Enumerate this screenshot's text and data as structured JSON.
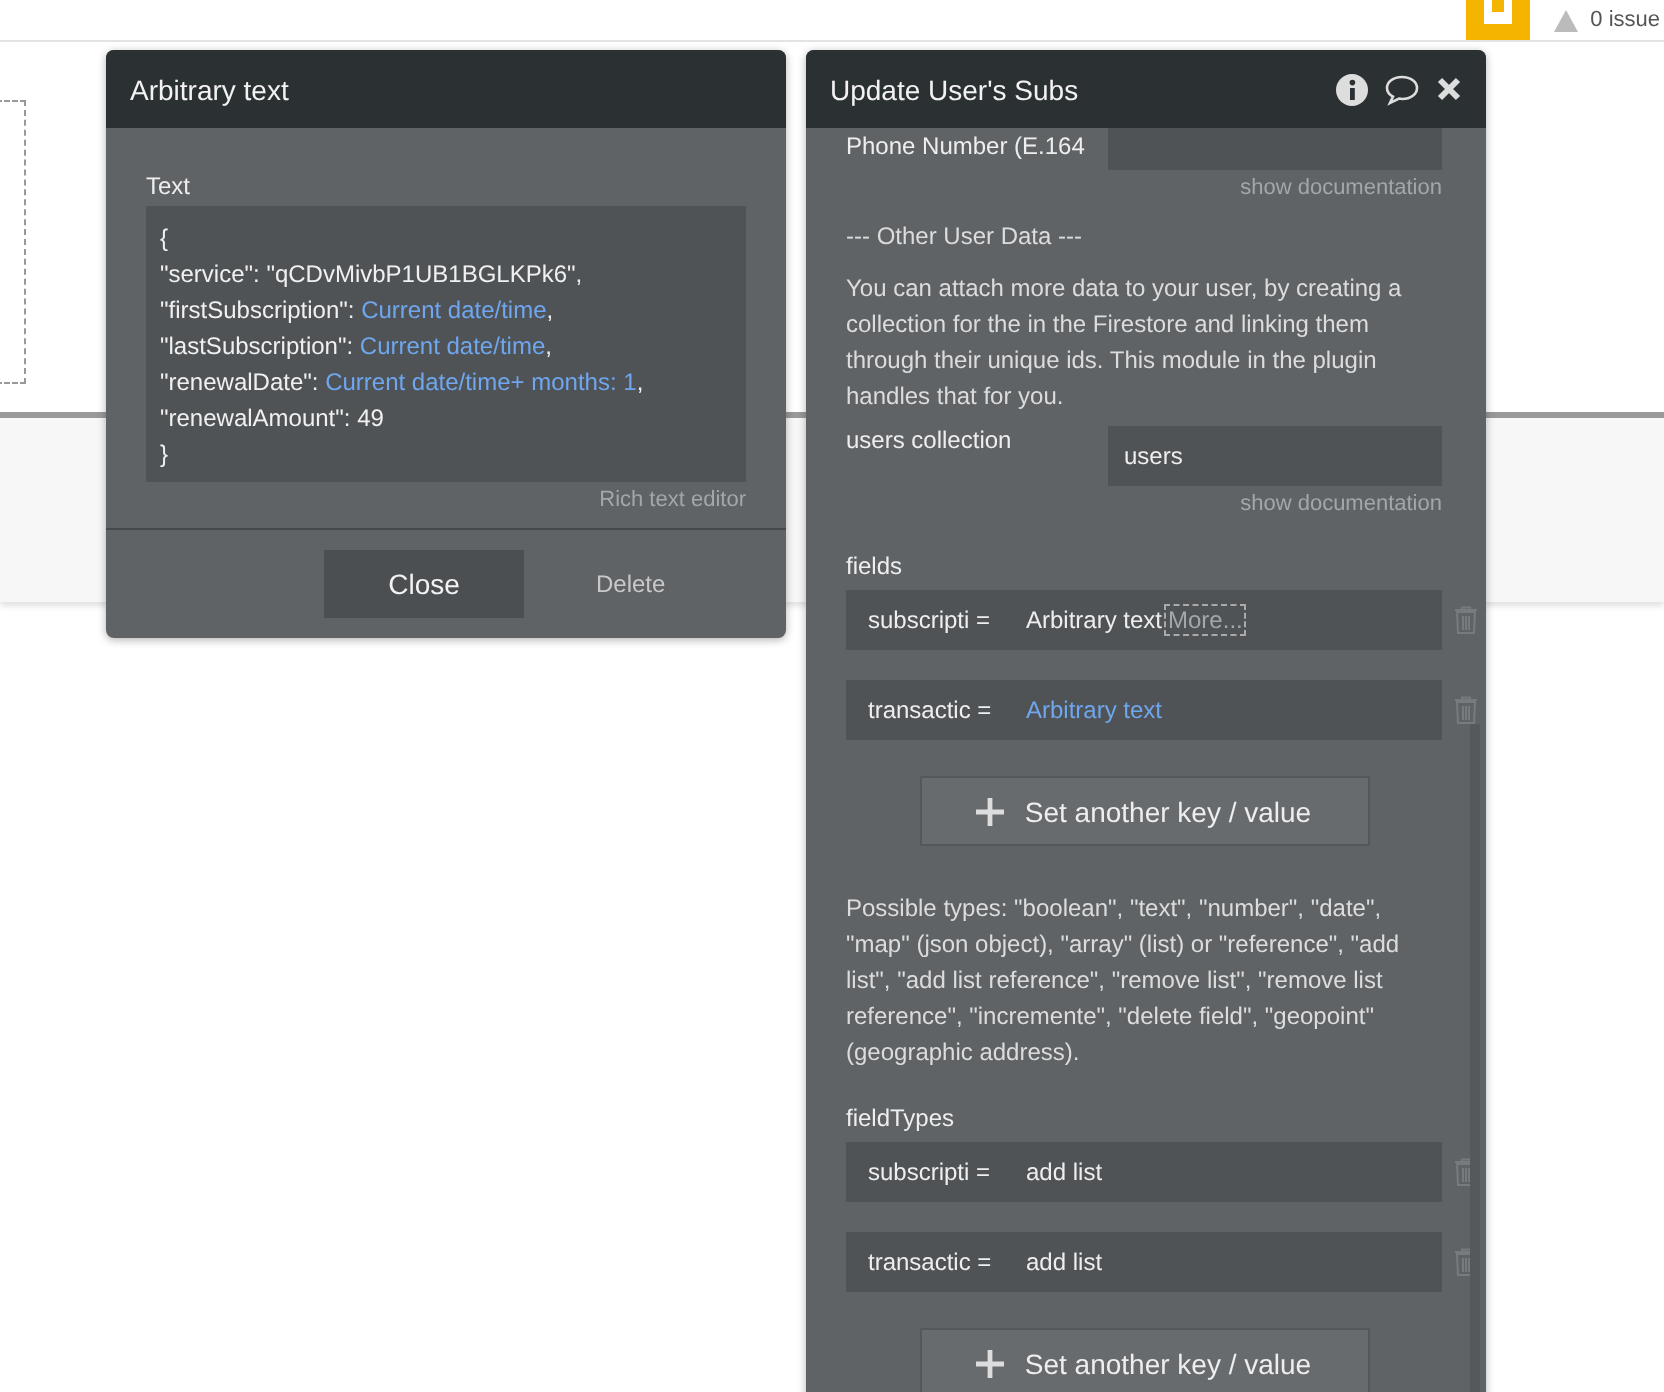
{
  "topbar": {
    "issues": "0 issue"
  },
  "text_editor": {
    "title": "Arbitrary text",
    "label": "Text",
    "lines": [
      [
        {
          "text": "{",
          "kind": "plain"
        }
      ],
      [
        {
          "text": "\"service\": \"qCDvMivbP1UB1BGLKPk6\",",
          "kind": "plain"
        }
      ],
      [
        {
          "text": "\"firstSubscription\": ",
          "kind": "plain"
        },
        {
          "text": "Current date/time",
          "kind": "dynamic"
        },
        {
          "text": ",",
          "kind": "plain"
        }
      ],
      [
        {
          "text": "\"lastSubscription\": ",
          "kind": "plain"
        },
        {
          "text": "Current date/time",
          "kind": "dynamic"
        },
        {
          "text": ",",
          "kind": "plain"
        }
      ],
      [
        {
          "text": "\"renewalDate\": ",
          "kind": "plain"
        },
        {
          "text": "Current date/time+ months: 1",
          "kind": "dynamic"
        },
        {
          "text": ",",
          "kind": "plain"
        }
      ],
      [
        {
          "text": "\"renewalAmount\": 49",
          "kind": "plain"
        }
      ],
      [
        {
          "text": "}",
          "kind": "plain"
        }
      ]
    ],
    "rich_text_link": "Rich text editor",
    "close_button": "Close",
    "delete_button": "Delete"
  },
  "action_panel": {
    "title": "Update User's Subs",
    "items": [
      {
        "kind": "input",
        "label": "Phone Number (E.164"
      },
      {
        "kind": "doc",
        "text": "show documentation"
      },
      {
        "kind": "note",
        "text": "--- Other User Data ---"
      },
      {
        "kind": "note",
        "text": "You can attach more data to your user, by creating a collection for the in the Firestore and linking them through their unique ids. This module in the plugin handles that for you."
      },
      {
        "kind": "input",
        "label": "users collection",
        "value": "users"
      },
      {
        "kind": "doc",
        "text": "show documentation"
      },
      {
        "kind": "heading",
        "text": "fields"
      },
      {
        "kind": "pair",
        "key": "subscripti =",
        "value": "Arbitrary text",
        "dynamic": false,
        "more": "More..."
      },
      {
        "kind": "pair",
        "key": "transactic =",
        "value": "Arbitrary text",
        "dynamic": true
      },
      {
        "kind": "add",
        "text": "Set another key / value"
      },
      {
        "kind": "note",
        "text": "Possible types: \"boolean\", \"text\", \"number\", \"date\", \"map\" (json object), \"array\" (list) or \"reference\", \"add list\", \"add list reference\", \"remove list\", \"remove list reference\", \"incremente\", \"delete field\", \"geopoint\" (geographic address)."
      },
      {
        "kind": "heading",
        "text": "fieldTypes"
      },
      {
        "kind": "pair",
        "key": "subscripti =",
        "value": "add list",
        "dynamic": false
      },
      {
        "kind": "pair",
        "key": "transactic =",
        "value": "add list",
        "dynamic": false
      },
      {
        "kind": "add",
        "text": "Set another key / value"
      }
    ]
  }
}
